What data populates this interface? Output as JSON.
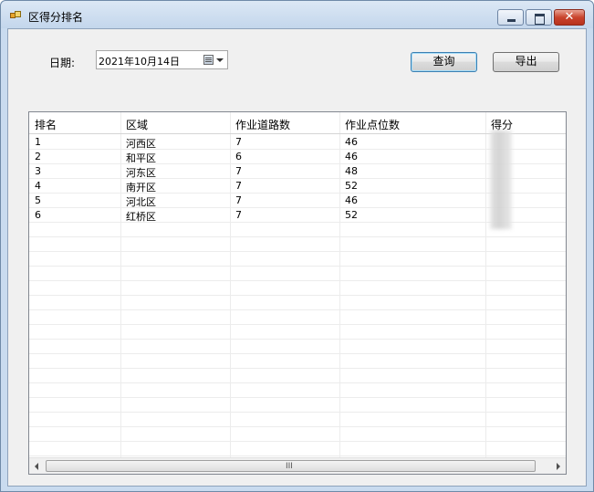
{
  "window": {
    "title": "区得分排名"
  },
  "filters": {
    "date_label": "日期:",
    "date_value": "2021年10月14日"
  },
  "buttons": {
    "query": "查询",
    "export": "导出"
  },
  "table": {
    "columns": [
      "排名",
      "区域",
      "作业道路数",
      "作业点位数",
      "得分"
    ],
    "rows": [
      [
        "1",
        "河西区",
        "7",
        "46",
        ""
      ],
      [
        "2",
        "和平区",
        "6",
        "46",
        ""
      ],
      [
        "3",
        "河东区",
        "7",
        "48",
        ""
      ],
      [
        "4",
        "南开区",
        "7",
        "52",
        ""
      ],
      [
        "5",
        "河北区",
        "7",
        "46",
        ""
      ],
      [
        "6",
        "红桥区",
        "7",
        "52",
        ""
      ]
    ]
  },
  "scrollbar": {
    "grip": "III"
  }
}
